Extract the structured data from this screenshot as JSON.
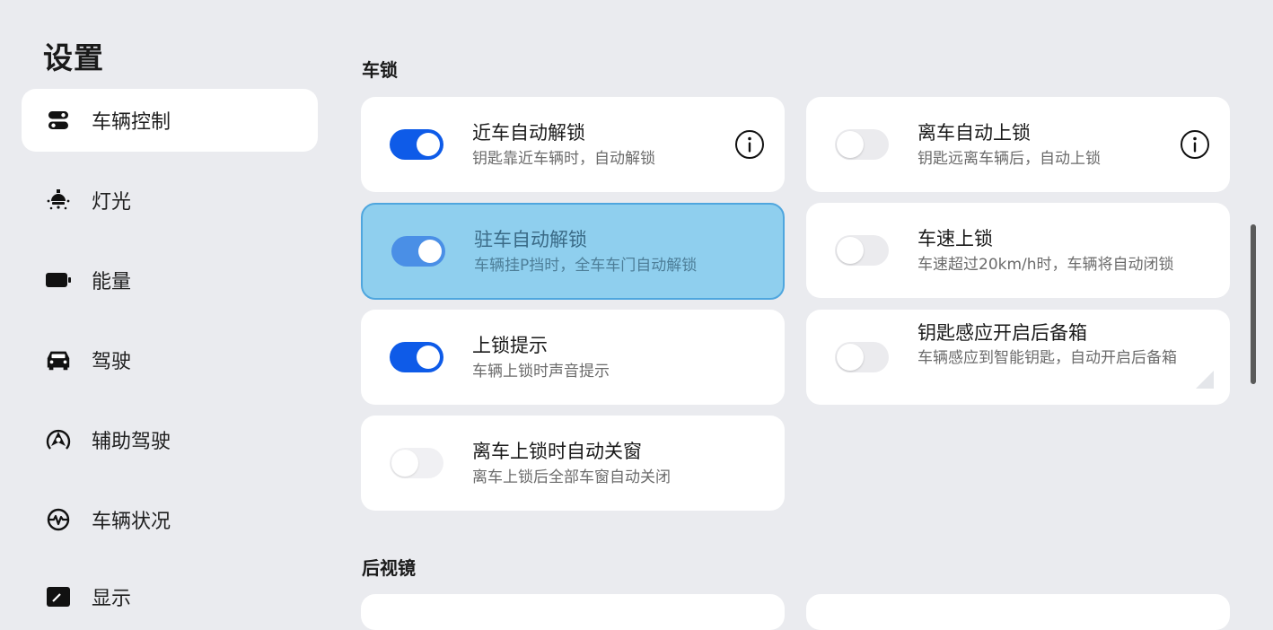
{
  "page": {
    "title": "设置"
  },
  "sidebar": {
    "items": [
      {
        "label": "车辆控制",
        "icon": "vehicle-control-icon",
        "active": true
      },
      {
        "label": "灯光",
        "icon": "light-icon"
      },
      {
        "label": "能量",
        "icon": "battery-icon"
      },
      {
        "label": "驾驶",
        "icon": "car-icon"
      },
      {
        "label": "辅助驾驶",
        "icon": "assisted-driving-icon"
      },
      {
        "label": "车辆状况",
        "icon": "vehicle-status-icon"
      },
      {
        "label": "显示",
        "icon": "display-icon"
      }
    ]
  },
  "sections": {
    "lock": {
      "title": "车锁"
    },
    "mirror": {
      "title": "后视镜"
    }
  },
  "cards": [
    {
      "title": "近车自动解锁",
      "subtitle": "钥匙靠近车辆时，自动解锁",
      "on": true,
      "info": true
    },
    {
      "title": "离车自动上锁",
      "subtitle": "钥匙远离车辆后，自动上锁",
      "on": false,
      "info": true
    },
    {
      "title": "驻车自动解锁",
      "subtitle": "车辆挂P挡时，全车车门自动解锁",
      "on": true,
      "highlighted": true
    },
    {
      "title": "车速上锁",
      "subtitle": "车速超过20km/h时，车辆将自动闭锁",
      "on": false
    },
    {
      "title": "上锁提示",
      "subtitle": "车辆上锁时声音提示",
      "on": true
    },
    {
      "title": "钥匙感应开启后备箱",
      "subtitle": "车辆感应到智能钥匙，自动开启后备箱",
      "on": false
    },
    {
      "title": "离车上锁时自动关窗",
      "subtitle": "离车上锁后全部车窗自动关闭",
      "on": false,
      "dimmed": true
    }
  ],
  "colors": {
    "accent": "#0e5be8",
    "highlight": "#8fcfee",
    "background": "#eaebef"
  }
}
